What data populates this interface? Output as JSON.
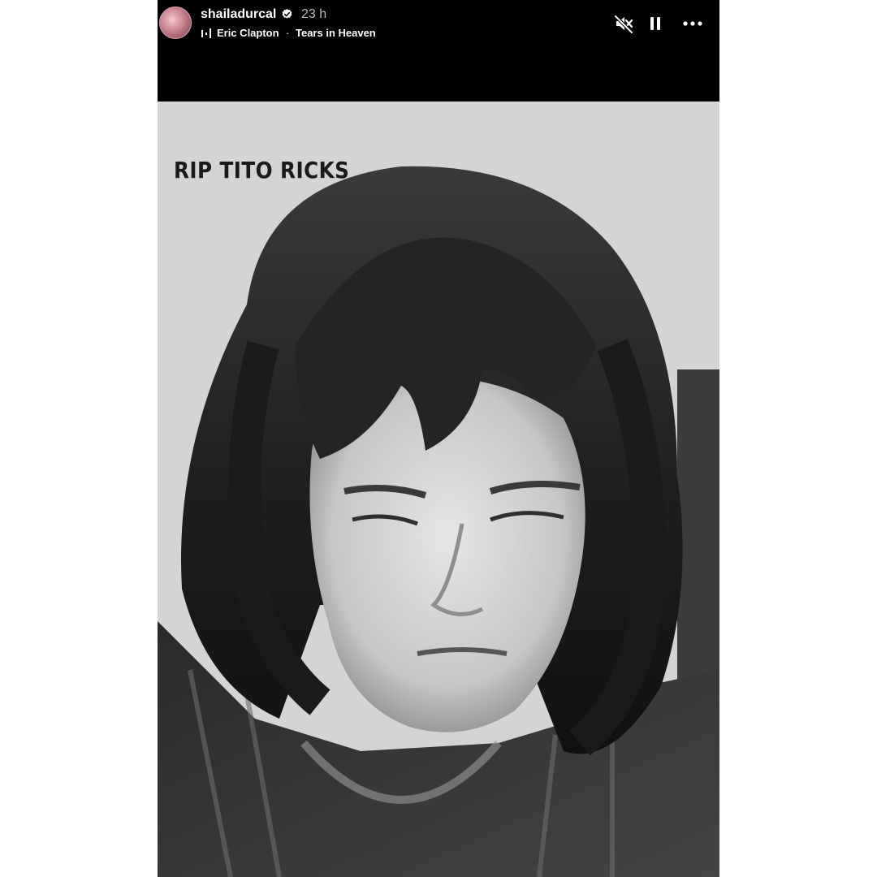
{
  "story": {
    "username": "shailadurcal",
    "time_ago": "23 h",
    "music": {
      "artist": "Eric Clapton",
      "separator": "·",
      "title": "Tears in Heaven"
    },
    "controls": {
      "mute_icon": "speaker-muted-icon",
      "pause_icon": "pause-icon",
      "more_icon": "more-horizontal-icon"
    },
    "caption": "RIP TITO RICKS"
  }
}
